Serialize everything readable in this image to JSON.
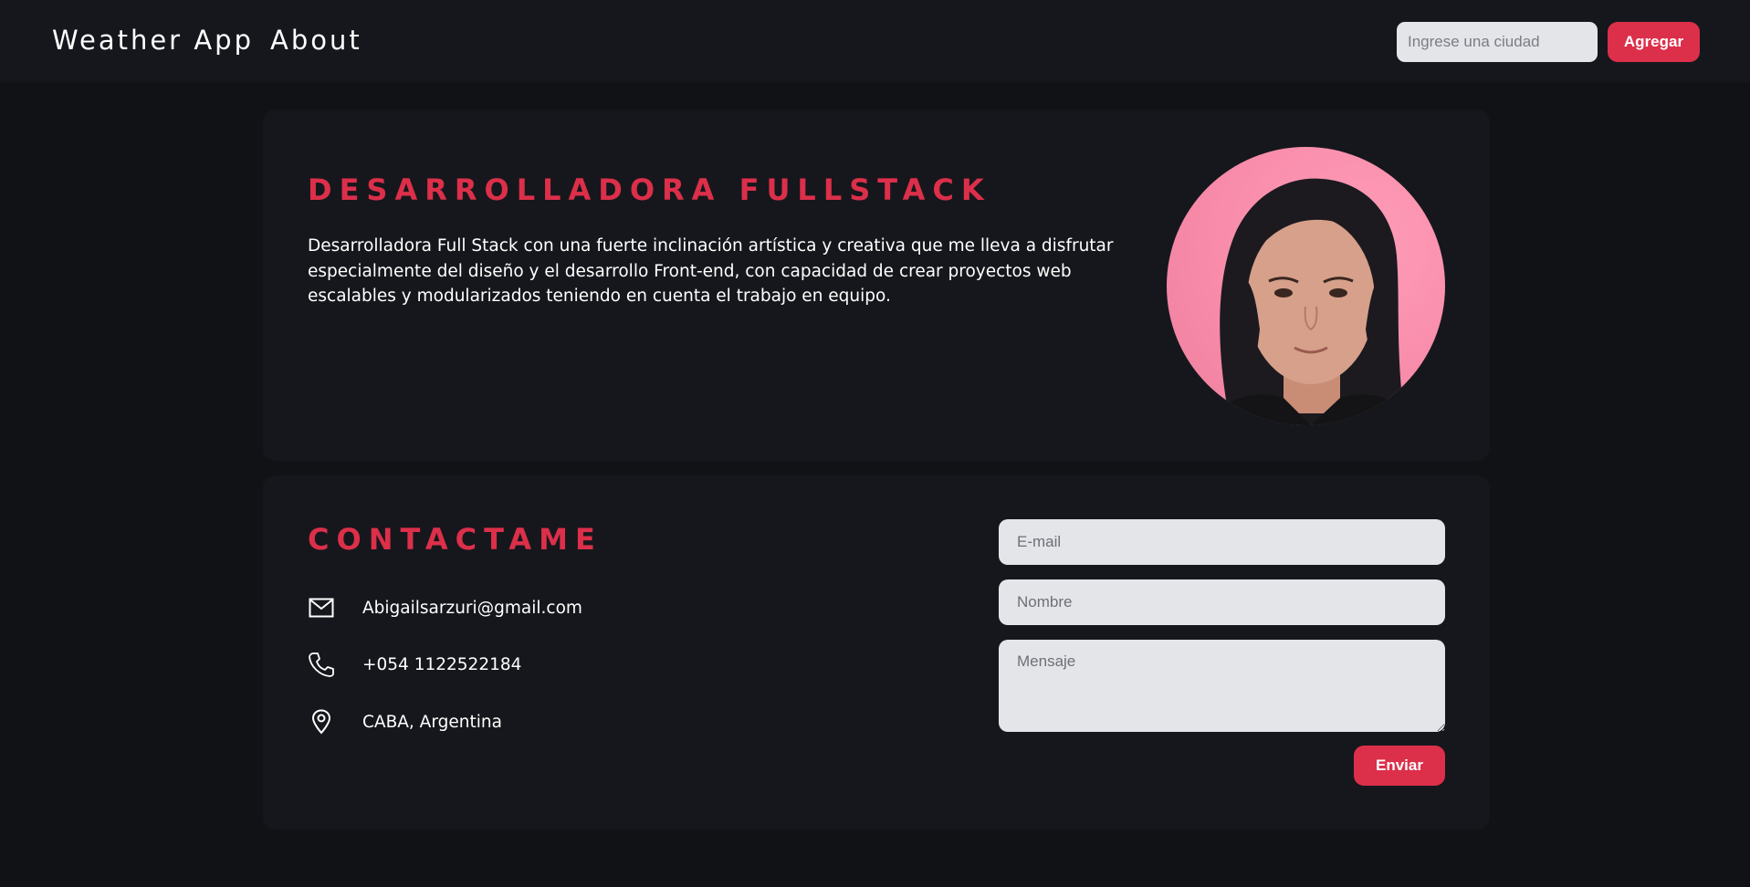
{
  "nav": {
    "links": [
      {
        "label": "Weather App"
      },
      {
        "label": "About"
      }
    ],
    "search": {
      "placeholder": "Ingrese una ciudad",
      "value": ""
    },
    "add_button": "Agregar"
  },
  "about": {
    "title": "DESARROLLADORA FULLSTACK",
    "description": "Desarrolladora Full Stack con una fuerte inclinación artística y creativa que me lleva a disfrutar especialmente del diseño y el desarrollo Front-end, con capacidad de crear proyectos web escalables y modularizados teniendo en cuenta el trabajo en equipo.",
    "photo_icon": "profile-photo"
  },
  "contact": {
    "title": "CONTACTAME",
    "items": [
      {
        "icon": "mail-icon",
        "text": "Abigailsarzuri@gmail.com"
      },
      {
        "icon": "phone-icon",
        "text": "+054 1122522184"
      },
      {
        "icon": "location-pin-icon",
        "text": "CABA, Argentina"
      }
    ],
    "form": {
      "email_placeholder": "E-mail",
      "name_placeholder": "Nombre",
      "message_placeholder": "Mensaje",
      "send_button": "Enviar"
    }
  },
  "colors": {
    "accent": "#dc2f4a",
    "background": "#111216",
    "card": "#16171c",
    "input": "#e4e5e9"
  }
}
